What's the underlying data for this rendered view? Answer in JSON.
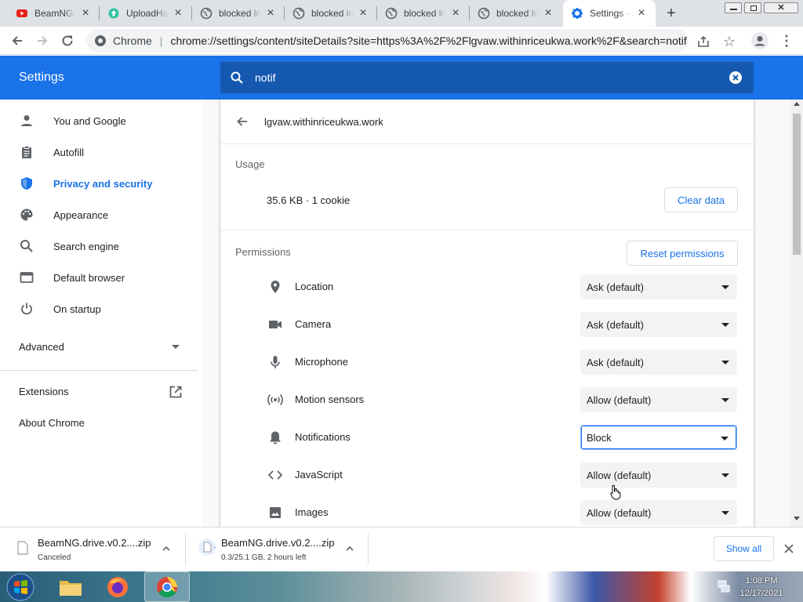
{
  "colors": {
    "accent": "#1a73e8",
    "header": "#1a73e8",
    "tabstrip": "#dee1e6"
  },
  "tabs": [
    {
      "title": "BeamNG.d",
      "icon": "youtube-icon"
    },
    {
      "title": "UploadHaven",
      "icon": "uploadhaven-icon"
    },
    {
      "title": "blocked ln",
      "icon": "globe-icon"
    },
    {
      "title": "blocked ln",
      "icon": "globe-icon"
    },
    {
      "title": "blocked ln",
      "icon": "globe-icon"
    },
    {
      "title": "blocked ln",
      "icon": "globe-icon"
    },
    {
      "title": "Settings - ",
      "icon": "gear-icon",
      "active": true
    }
  ],
  "toolbar": {
    "scheme_label": "Chrome",
    "url": "chrome://settings/content/siteDetails?site=https%3A%2F%2Flgvaw.withinriceukwa.work%2F&search=notif"
  },
  "header": {
    "title": "Settings",
    "search_value": "notif"
  },
  "sidebar": {
    "items": [
      {
        "label": "You and Google",
        "icon": "person-icon"
      },
      {
        "label": "Autofill",
        "icon": "clipboard-icon"
      },
      {
        "label": "Privacy and security",
        "icon": "shield-icon",
        "selected": true
      },
      {
        "label": "Appearance",
        "icon": "palette-icon"
      },
      {
        "label": "Search engine",
        "icon": "search-icon"
      },
      {
        "label": "Default browser",
        "icon": "browser-icon"
      },
      {
        "label": "On startup",
        "icon": "power-icon"
      }
    ],
    "advanced_label": "Advanced",
    "extensions_label": "Extensions",
    "about_label": "About Chrome"
  },
  "site": {
    "domain": "lgvaw.withinriceukwa.work",
    "usage_heading": "Usage",
    "usage_value": "35.6 KB · 1 cookie",
    "clear_data_label": "Clear data",
    "permissions_heading": "Permissions",
    "reset_label": "Reset permissions"
  },
  "permissions": [
    {
      "label": "Location",
      "value": "Ask (default)",
      "icon": "location-icon"
    },
    {
      "label": "Camera",
      "value": "Ask (default)",
      "icon": "camera-icon"
    },
    {
      "label": "Microphone",
      "value": "Ask (default)",
      "icon": "microphone-icon"
    },
    {
      "label": "Motion sensors",
      "value": "Allow (default)",
      "icon": "sensors-icon"
    },
    {
      "label": "Notifications",
      "value": "Block",
      "icon": "bell-icon",
      "focused": true
    },
    {
      "label": "JavaScript",
      "value": "Allow (default)",
      "icon": "code-icon"
    },
    {
      "label": "Images",
      "value": "Allow (default)",
      "icon": "image-icon"
    }
  ],
  "downloads": [
    {
      "filename": "BeamNG.drive.v0.2....zip",
      "status": "Canceled"
    },
    {
      "filename": "BeamNG.drive.v0.2....zip",
      "status": "0.3/25.1 GB, 2 hours left"
    }
  ],
  "download_shelf": {
    "show_all_label": "Show all"
  },
  "taskbar": {
    "time": "1:08 PM",
    "date": "12/17/2021"
  }
}
